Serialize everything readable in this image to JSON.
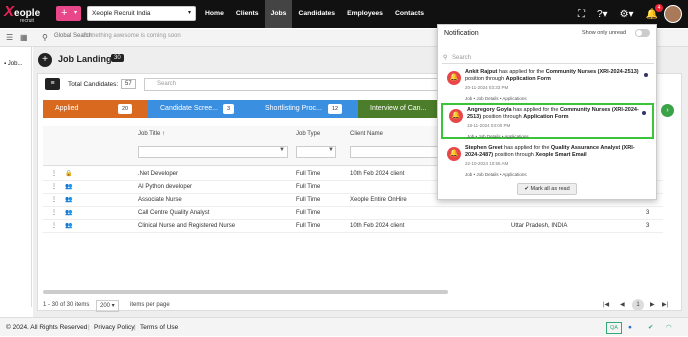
{
  "topbar": {
    "logo_x": "X",
    "logo_rest": "eople",
    "logo_sub": "recruit",
    "add_label": "+",
    "tenant": "Xeople Recruit India",
    "nav": [
      "Home",
      "Clients",
      "Jobs",
      "Candidates",
      "Employees",
      "Contacts"
    ],
    "active_nav": "Jobs",
    "notif_count": "4"
  },
  "search": {
    "label": "Global Search",
    "placeholder": "Something awesome is coming soon"
  },
  "left": {
    "tab": "Job..."
  },
  "page": {
    "title": "Job Landing",
    "count": "30",
    "total_label": "Total Candidates:",
    "total_value": "57",
    "search_placeholder": "Search"
  },
  "pipeline": [
    {
      "label": "Applied",
      "count": "20",
      "color": "#d9691e"
    },
    {
      "label": "Candidate Scree...",
      "count": "3",
      "color": "#3b8fe0"
    },
    {
      "label": "Shortlisting Proc...",
      "count": "12",
      "color": "#3b8fe0"
    },
    {
      "label": "Interview of Can...",
      "count": "",
      "color": "#4c7d2a"
    }
  ],
  "table": {
    "headers": [
      "Job Title",
      "Job Type",
      "Client Name"
    ],
    "sort_icon": "↑",
    "rows": [
      {
        "title": ".Net Developer",
        "type": "Full Time",
        "client": "10th Feb 2024 client",
        "extra": "",
        "num": ""
      },
      {
        "title": "AI Python developer",
        "type": "Full Time",
        "client": "",
        "extra": "",
        "num": ""
      },
      {
        "title": "Associate Nurse",
        "type": "Full Time",
        "client": "Xeople Entire OnHire",
        "extra": "",
        "num": ""
      },
      {
        "title": "Call Centre Quality Analyst",
        "type": "Full Time",
        "client": "",
        "extra": "",
        "num": "3"
      },
      {
        "title": "Clinical Nurse and Registered Nurse",
        "type": "Full Time",
        "client": "10th Feb 2024 client",
        "extra": "Uttar Pradesh, INDIA",
        "num": "3"
      }
    ]
  },
  "pager": {
    "range": "1 - 30 of 30 items",
    "per_page": "200",
    "per_label": "items per page",
    "page": "1"
  },
  "footer": {
    "copy": "© 2024. All Rights Reserved",
    "privacy": "Privacy Policy",
    "terms": "Terms of Use",
    "qa": "QA"
  },
  "notification": {
    "title": "Notification",
    "unread_label": "Show only unread",
    "search": "Search",
    "mark_all": "Mark all as read",
    "items": [
      {
        "name": "Ankit Rajput",
        "text_a": " has applied for the ",
        "job": "Community Nurses (XRI-2024-2513)",
        "text_b": " position through ",
        "via": "Application Form",
        "date": "20-11-2024 03:33 PM",
        "link": "Job • Job Details • Applications"
      },
      {
        "name": "Angregory Goyla",
        "text_a": " has applied for the ",
        "job": "Community Nurses (XRI-2024-2513)",
        "text_b": " position through ",
        "via": "Application Form",
        "date": "18-11-2024 03:00 PM",
        "link": "Job • Job Details • Applications"
      },
      {
        "name": "Stephen Greet",
        "text_a": " has applied for the ",
        "job": "Quality Assurance Analyst (XRI-2024-2487)",
        "text_b": " position through ",
        "via": "Xeople Smart Email",
        "date": "22-10-2024 10:55 AM",
        "link": "Job • Job Details • Applications"
      }
    ]
  }
}
